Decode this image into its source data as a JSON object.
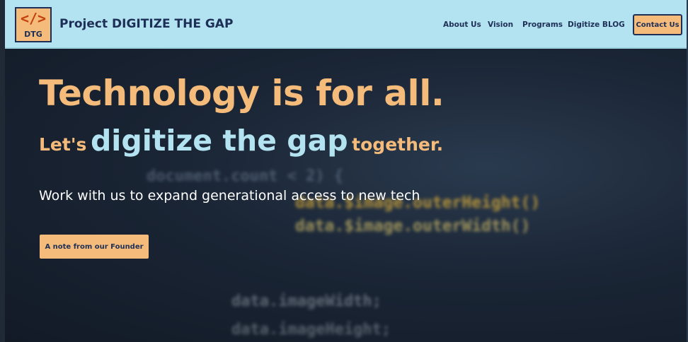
{
  "header": {
    "logo_glyph": "</>",
    "logo_text": "DTG",
    "brand_title": "Project DIGITIZE THE GAP",
    "nav": {
      "about": "About Us",
      "vision": "Vision",
      "programs": "Programs",
      "blog": "Digitize BLOG"
    },
    "contact_label": "Contact Us"
  },
  "hero": {
    "headline": "Technology is for all.",
    "sub_prefix": "Let's",
    "sub_emphasis": "digitize the gap",
    "sub_suffix": "together.",
    "tagline": "Work with us to expand generational access to new tech",
    "founder_button": "A note from our Founder",
    "background_code": {
      "line1": "document.count < 2) {",
      "line2": "data.$image.outerHeight()",
      "line3": "data.$image.outerWidth()",
      "line4": "data.imageWidth;",
      "line5": "data.imageHeight;"
    }
  },
  "colors": {
    "accent_orange": "#f5bb7a",
    "accent_light_blue": "#b3e3f0",
    "navy": "#1e2f57",
    "hero_dark": "#1a2535"
  },
  "icons": {
    "logo": "code-brackets-icon"
  }
}
